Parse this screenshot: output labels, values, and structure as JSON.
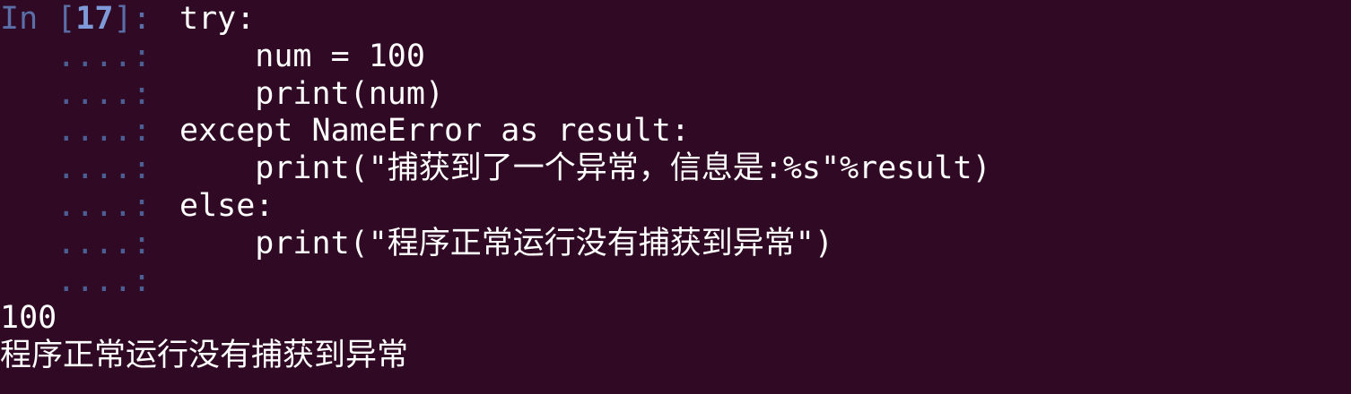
{
  "prompt": {
    "in_label": "In [",
    "cell_number": "17",
    "in_suffix": "]: ",
    "continuation": "   ....: "
  },
  "code_lines": [
    "try:",
    "    num = 100",
    "    print(num)",
    "except NameError as result:",
    "    print(\"捕获到了一个异常，信息是:%s\"%result)",
    "else:",
    "    print(\"程序正常运行没有捕获到异常\")",
    ""
  ],
  "output_lines": [
    "100",
    "程序正常运行没有捕获到异常"
  ],
  "colors": {
    "background": "#300a24",
    "prompt": "#5a6fa8",
    "prompt_number": "#7e9ad8",
    "text": "#ffffff"
  }
}
